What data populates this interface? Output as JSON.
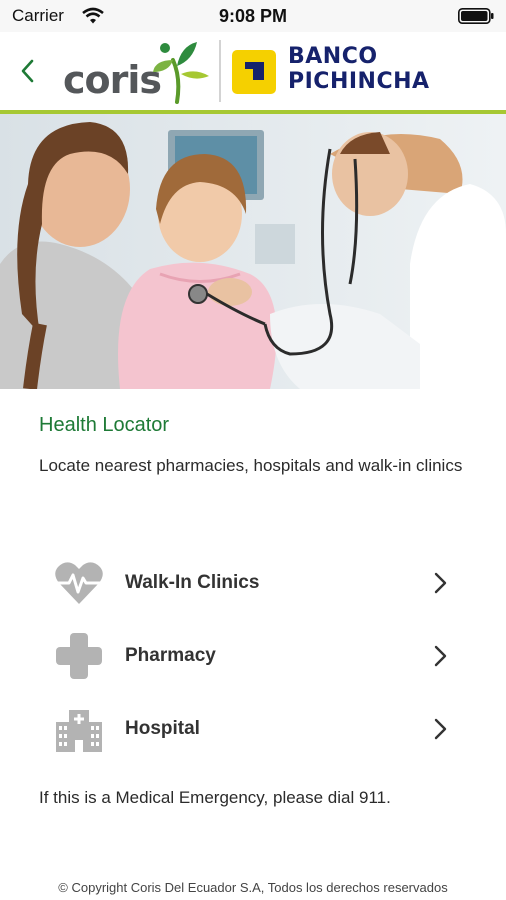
{
  "status_bar": {
    "carrier": "Carrier",
    "time": "9:08 PM"
  },
  "header": {
    "coris_brand": "coris",
    "bank_name_line1": "BANCO",
    "bank_name_line2": "PICHINCHA"
  },
  "content": {
    "title": "Health Locator",
    "description": "Locate nearest pharmacies, hospitals and walk-in clinics",
    "menu": [
      {
        "label": "Walk-In Clinics",
        "icon": "heartbeat-icon"
      },
      {
        "label": "Pharmacy",
        "icon": "medical-cross-icon"
      },
      {
        "label": "Hospital",
        "icon": "hospital-building-icon"
      }
    ],
    "emergency_note": "If this is a Medical Emergency, please dial 911."
  },
  "footer": {
    "copyright": "© Copyright Coris Del Ecuador S.A, Todos los derechos reservados"
  },
  "colors": {
    "accent_green": "#1e7a36",
    "bar_green": "#a6c833",
    "bank_navy": "#16226c",
    "bank_yellow": "#f5d000",
    "icon_gray": "#b3b3b3"
  }
}
